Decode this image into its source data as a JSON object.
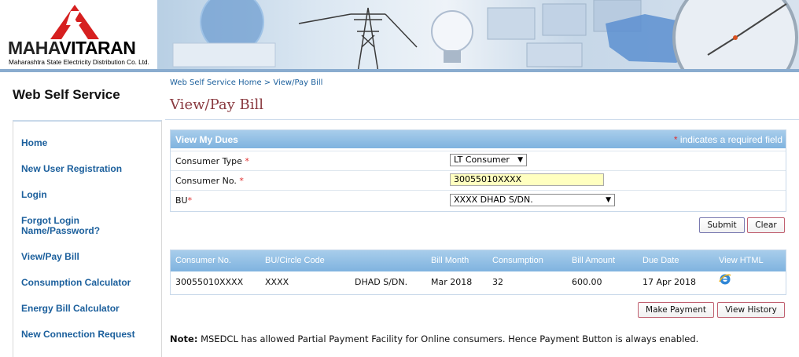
{
  "header": {
    "logo_text_a": "MAHA",
    "logo_text_b": "VITARAN",
    "logo_tagline": "Maharashtra State Electricity Distribution Co. Ltd."
  },
  "site_title": "Web Self Service",
  "nav": {
    "items": [
      {
        "label": "Home"
      },
      {
        "label": "New User Registration"
      },
      {
        "label": "Login"
      },
      {
        "label": "Forgot Login Name/Password?"
      },
      {
        "label": "View/Pay Bill"
      },
      {
        "label": "Consumption Calculator"
      },
      {
        "label": "Energy Bill Calculator"
      },
      {
        "label": "New Connection Request"
      }
    ]
  },
  "breadcrumb": "Web Self Service Home > View/Pay Bill",
  "page_title": "View/Pay Bill",
  "dues": {
    "heading": "View My Dues",
    "required_note": "indicates a required field",
    "required_mark": "*",
    "consumer_type_label": "Consumer Type",
    "consumer_type_value": "LT Consumer",
    "consumer_no_label": "Consumer No.",
    "consumer_no_value": "30055010XXXX",
    "bu_label": "BU",
    "bu_value": "XXXX DHAD S/DN.",
    "submit_label": "Submit",
    "clear_label": "Clear"
  },
  "results": {
    "columns": [
      "Consumer No.",
      "BU/Circle Code",
      "Bill Month",
      "Consumption",
      "Bill Amount",
      "Due Date",
      "View HTML"
    ],
    "row": {
      "consumer_no": "30055010XXXX",
      "bu_code": "XXXX",
      "circle": "DHAD S/DN.",
      "bill_month": "Mar 2018",
      "consumption": "32",
      "bill_amount": "600.00",
      "due_date": "17 Apr 2018",
      "view_icon": "ie-browser-icon"
    }
  },
  "make_payment_label": "Make Payment",
  "view_history_label": "View History",
  "note": {
    "prefix": "Note:",
    "text": " MSEDCL has allowed Partial Payment Facility for Online consumers. Hence Payment Button is always enabled."
  },
  "colors": {
    "link": "#1b5f9c",
    "title": "#8a3a40",
    "panel_header": "#7fb3df",
    "required": "#e03030",
    "input_highlight": "#ffffc0"
  }
}
